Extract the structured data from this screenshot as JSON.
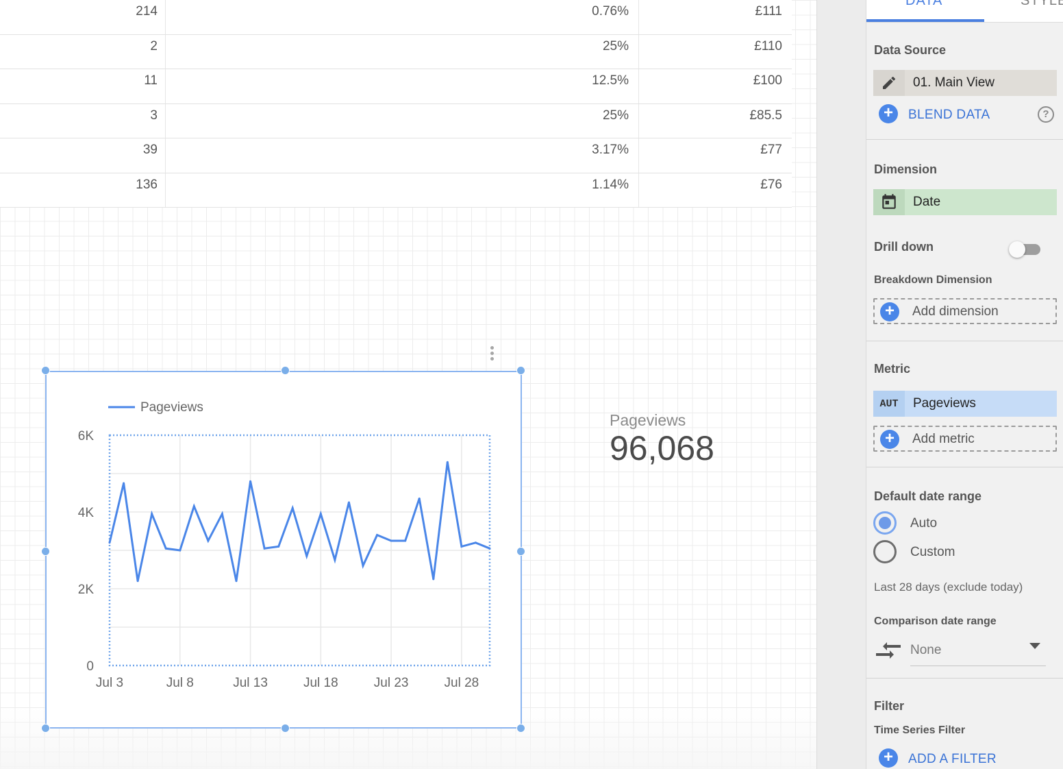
{
  "table": {
    "rows": [
      {
        "c1": "214",
        "c2": "0.76%",
        "c3": "£111"
      },
      {
        "c1": "2",
        "c2": "25%",
        "c3": "£110"
      },
      {
        "c1": "11",
        "c2": "12.5%",
        "c3": "£100"
      },
      {
        "c1": "3",
        "c2": "25%",
        "c3": "£85.5"
      },
      {
        "c1": "39",
        "c2": "3.17%",
        "c3": "£77"
      },
      {
        "c1": "136",
        "c2": "1.14%",
        "c3": "£76"
      }
    ]
  },
  "chart_data": {
    "type": "line",
    "title": "",
    "xlabel": "",
    "ylabel": "",
    "ylim": [
      0,
      6000
    ],
    "yticks": [
      "0",
      "2K",
      "4K",
      "6K"
    ],
    "xticks": [
      "Jul 3",
      "Jul 8",
      "Jul 13",
      "Jul 18",
      "Jul 23",
      "Jul 28"
    ],
    "x": [
      "Jul 3",
      "Jul 4",
      "Jul 5",
      "Jul 6",
      "Jul 7",
      "Jul 8",
      "Jul 9",
      "Jul 10",
      "Jul 11",
      "Jul 12",
      "Jul 13",
      "Jul 14",
      "Jul 15",
      "Jul 16",
      "Jul 17",
      "Jul 18",
      "Jul 19",
      "Jul 20",
      "Jul 21",
      "Jul 22",
      "Jul 23",
      "Jul 24",
      "Jul 25",
      "Jul 26",
      "Jul 27",
      "Jul 28",
      "Jul 29",
      "Jul 30"
    ],
    "series": [
      {
        "name": "Pageviews",
        "color": "#4a86e8",
        "values": [
          3200,
          4750,
          2200,
          3950,
          3050,
          3000,
          4150,
          3250,
          3950,
          2200,
          4800,
          3050,
          3100,
          4100,
          2850,
          3950,
          2750,
          4250,
          2600,
          3400,
          3250,
          3250,
          4350,
          2250,
          5300,
          3100,
          3200,
          3050
        ]
      }
    ],
    "legend": "top-left",
    "grid": true
  },
  "scorecard": {
    "label": "Pageviews",
    "value": "96,068"
  },
  "panel": {
    "tabs": {
      "data": "DATA",
      "style": "STYLE"
    },
    "data_source_title": "Data Source",
    "data_source_value": "01. Main View",
    "blend_data": "BLEND DATA",
    "dimension_title": "Dimension",
    "dimension_value": "Date",
    "drill_down": "Drill down",
    "breakdown_title": "Breakdown Dimension",
    "add_dimension": "Add dimension",
    "metric_title": "Metric",
    "metric_type": "AUT",
    "metric_value": "Pageviews",
    "add_metric": "Add metric",
    "date_range_title": "Default date range",
    "auto_label": "Auto",
    "custom_label": "Custom",
    "date_range_note": "Last 28 days (exclude today)",
    "comparison_title": "Comparison date range",
    "comparison_value": "None",
    "filter_title": "Filter",
    "time_series_filter": "Time Series Filter",
    "add_filter": "ADD A FILTER"
  },
  "colors": {
    "accent": "#4a86e8",
    "selection": "#8ab4f0",
    "dimension_chip": "#cde6cd",
    "metric_chip": "#c6dcf7"
  }
}
